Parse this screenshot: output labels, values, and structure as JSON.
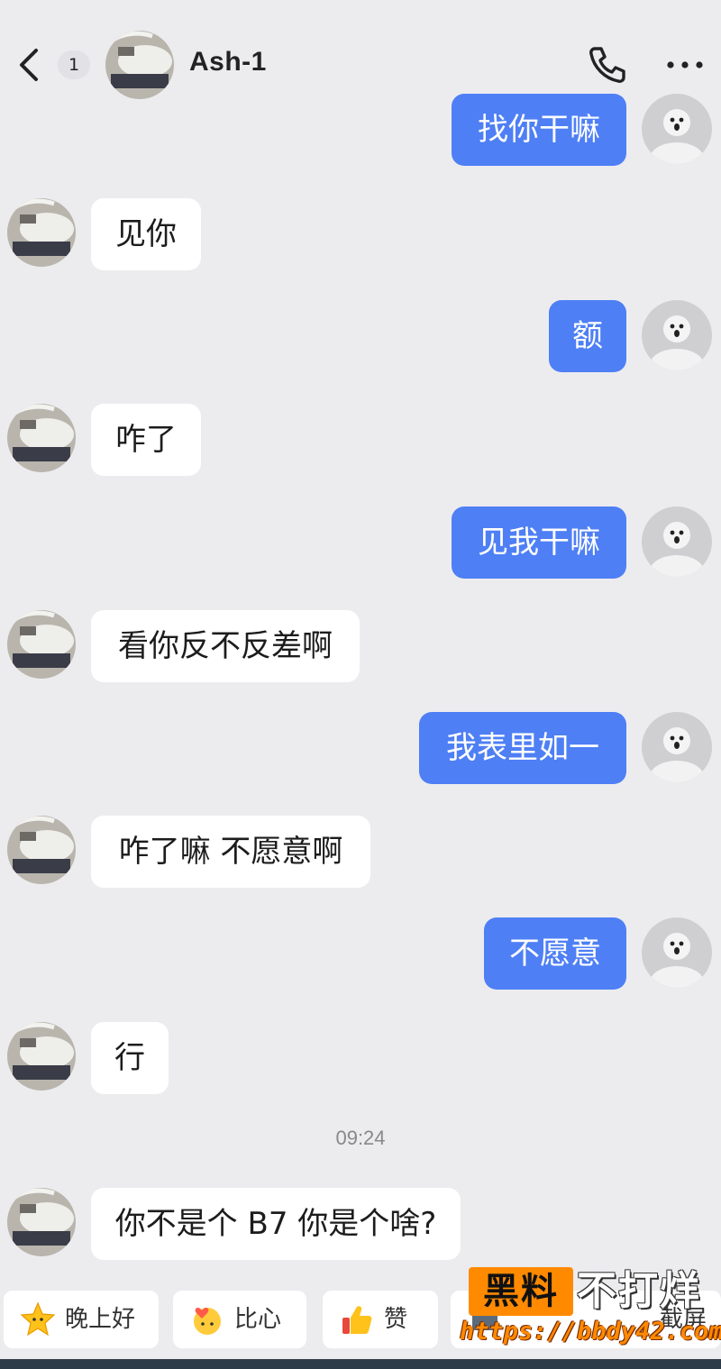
{
  "header": {
    "unread_count": "1",
    "contact_name": "Ash-1"
  },
  "messages": [
    {
      "side": "out",
      "text": "找你干嘛"
    },
    {
      "side": "in",
      "text": "见你"
    },
    {
      "side": "out",
      "text": "额"
    },
    {
      "side": "in",
      "text": "咋了"
    },
    {
      "side": "out",
      "text": "见我干嘛"
    },
    {
      "side": "in",
      "text": "看你反不反差啊"
    },
    {
      "side": "out",
      "text": "我表里如一"
    },
    {
      "side": "in",
      "text": "咋了嘛 不愿意啊"
    },
    {
      "side": "out",
      "text": "不愿意"
    },
    {
      "side": "in",
      "text": "行"
    },
    {
      "side": "in",
      "text": "你不是个 B7 你是个啥?"
    }
  ],
  "timestamp": "09:24",
  "quick_replies": [
    {
      "label": "晚上好",
      "icon": "star-emoji-icon"
    },
    {
      "label": "比心",
      "icon": "heart-hands-emoji-icon"
    },
    {
      "label": "赞",
      "icon": "thumbs-up-emoji-icon"
    },
    {
      "label": "截屏",
      "icon": "screenshot-emoji-icon"
    }
  ],
  "watermark": {
    "box_text": "黑料",
    "text": "不打烊",
    "url": "https://bbdy42.com"
  },
  "colors": {
    "background": "#ececef",
    "outgoing_bubble": "#4e7ff5",
    "incoming_bubble": "#ffffff",
    "watermark_accent": "#ff8a00"
  }
}
